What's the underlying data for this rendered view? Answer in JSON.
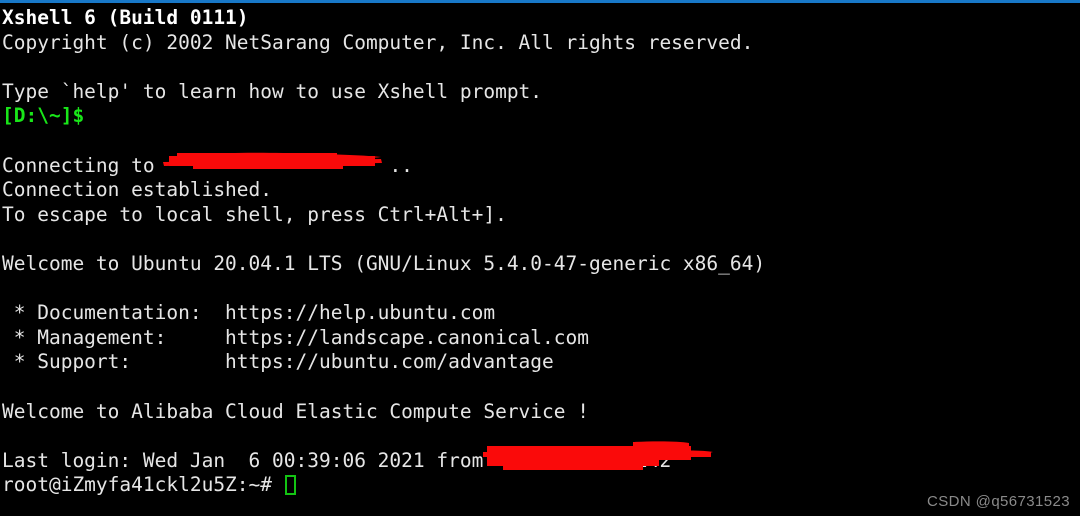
{
  "window": {
    "titlebar_color": "#1878c8",
    "background_color": "#000000",
    "foreground_color": "#e6e6e6",
    "prompt_color": "#19e619",
    "redaction_color": "#fa0a0a"
  },
  "terminal": {
    "app_title": "Xshell 6 (Build 0111)",
    "copyright": "Copyright (c) 2002 NetSarang Computer, Inc. All rights reserved.",
    "blank_1": " ",
    "help_hint": "Type `help' to learn how to use Xshell prompt.",
    "local_prompt": "[D:\\~]$",
    "blank_2": " ",
    "connecting": "Connecting to ",
    "connecting_suffix": "..",
    "connection_established": "Connection established.",
    "escape_hint": "To escape to local shell, press Ctrl+Alt+].",
    "blank_3": " ",
    "welcome_ubuntu": "Welcome to Ubuntu 20.04.1 LTS (GNU/Linux 5.4.0-47-generic x86_64)",
    "blank_4": " ",
    "documentation_line": " * Documentation:  https://help.ubuntu.com",
    "management_line": " * Management:     https://landscape.canonical.com",
    "support_line": " * Support:        https://ubuntu.com/advantage",
    "blank_5": " ",
    "welcome_alibaba": "Welcome to Alibaba Cloud Elastic Compute Service !",
    "blank_6": " ",
    "last_login": "Last login: Wed Jan  6 00:39:06 2021 from",
    "last_login_visible_tail": ".242",
    "shell_prompt": "root@iZmyfa41ckl2u5Z:~# "
  },
  "watermark": {
    "text": "CSDN @q56731523"
  }
}
